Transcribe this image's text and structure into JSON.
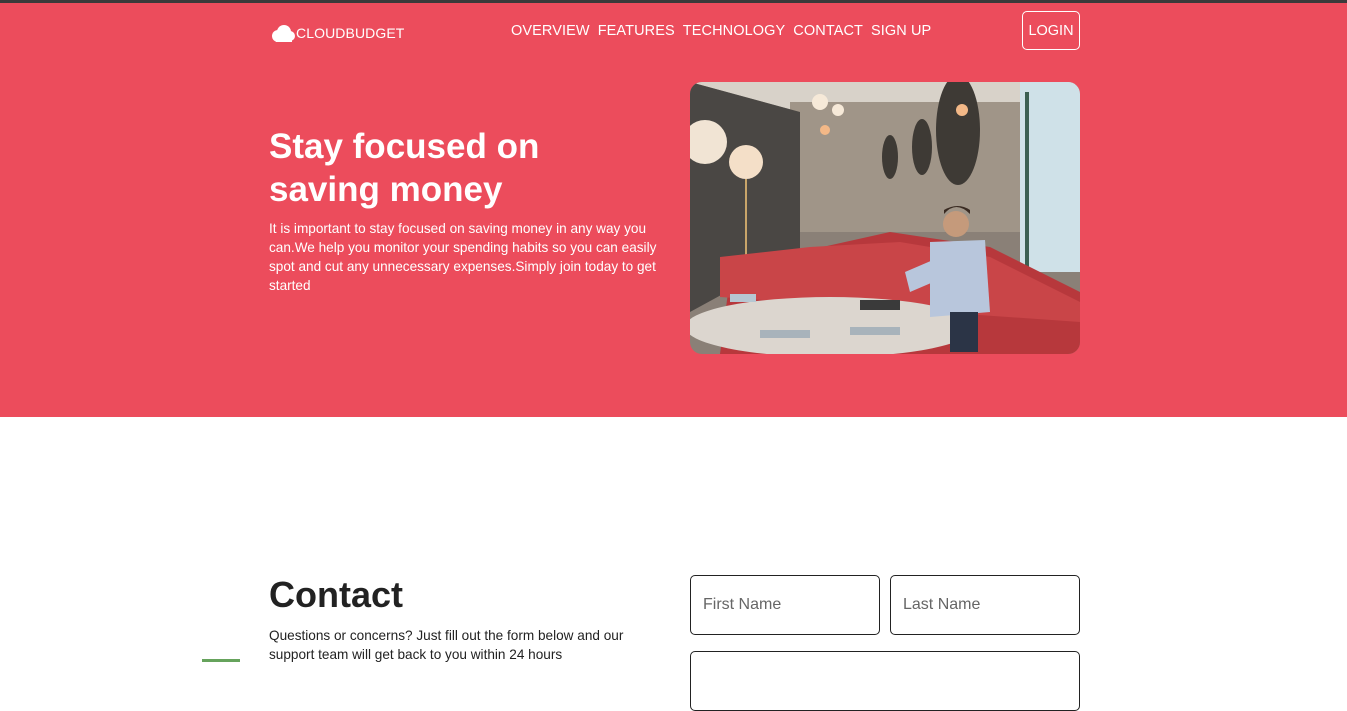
{
  "brand": {
    "name": "CLOUDBUDGET",
    "icon": "cloud-icon"
  },
  "nav": {
    "items": [
      "OVERVIEW",
      "FEATURES",
      "TECHNOLOGY",
      "CONTACT",
      "SIGN UP"
    ]
  },
  "login": {
    "label": "LOGIN"
  },
  "hero": {
    "title": "Stay focused on saving money",
    "text": "It is important to stay focused on saving money in any way you can.We help you monitor your spending habits so you can easily spot and cut any unnecessary expenses.Simply join today to get started"
  },
  "contact": {
    "title": "Contact",
    "text": "Questions or concerns? Just fill out the form below and our support team will get back to you within 24 hours",
    "first_name_placeholder": "First Name",
    "last_name_placeholder": "Last Name"
  },
  "colors": {
    "accent": "#ec4c5c",
    "text_dark": "#222222"
  }
}
